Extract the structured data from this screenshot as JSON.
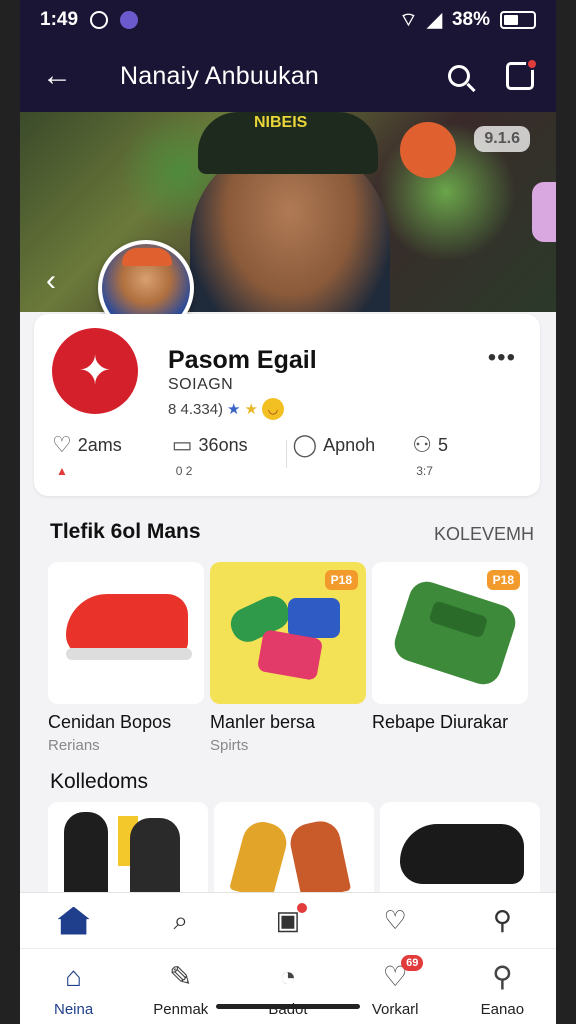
{
  "status_bar": {
    "time": "1:49",
    "battery": "38%"
  },
  "app_bar": {
    "title": "Nanaiy Anbuukan"
  },
  "hero": {
    "badge": "9.1.6",
    "cap_text": "NIBEIS"
  },
  "profile": {
    "name": "Pasom Egail",
    "subtitle": "SOIAGN",
    "rating": "8 4.334)",
    "stats": [
      {
        "label": "2ams",
        "sub": ""
      },
      {
        "label": "36ons",
        "sub": "0 2"
      },
      {
        "label": "Apnoh",
        "sub": ""
      },
      {
        "label": "5",
        "sub": "3:7"
      }
    ]
  },
  "featured": {
    "title": "Tlefik 6ol Mans",
    "link": "KOLEVEMH",
    "products": [
      {
        "name": "Cenidan Bopos",
        "category": "Rerians",
        "badge": ""
      },
      {
        "name": "Manler bersa",
        "category": "Spirts",
        "badge": "P18"
      },
      {
        "name": "Rebape Diurakar",
        "category": "",
        "badge": "P18"
      }
    ]
  },
  "collections": {
    "title": "Kolledoms"
  },
  "bottom_nav": [
    {
      "label": "Neina",
      "icon": "home-icon"
    },
    {
      "label": "Penmak",
      "icon": "edit-icon"
    },
    {
      "label": "Badot",
      "icon": "thumb-icon"
    },
    {
      "label": "Vorkarl",
      "icon": "heart-icon",
      "badge": "69"
    },
    {
      "label": "Eanao",
      "icon": "user-icon"
    }
  ],
  "colors": {
    "primary": "#1b1535",
    "accent": "#1f3f8c",
    "brand_red": "#d4202a",
    "badge_orange": "#f29b2c"
  }
}
